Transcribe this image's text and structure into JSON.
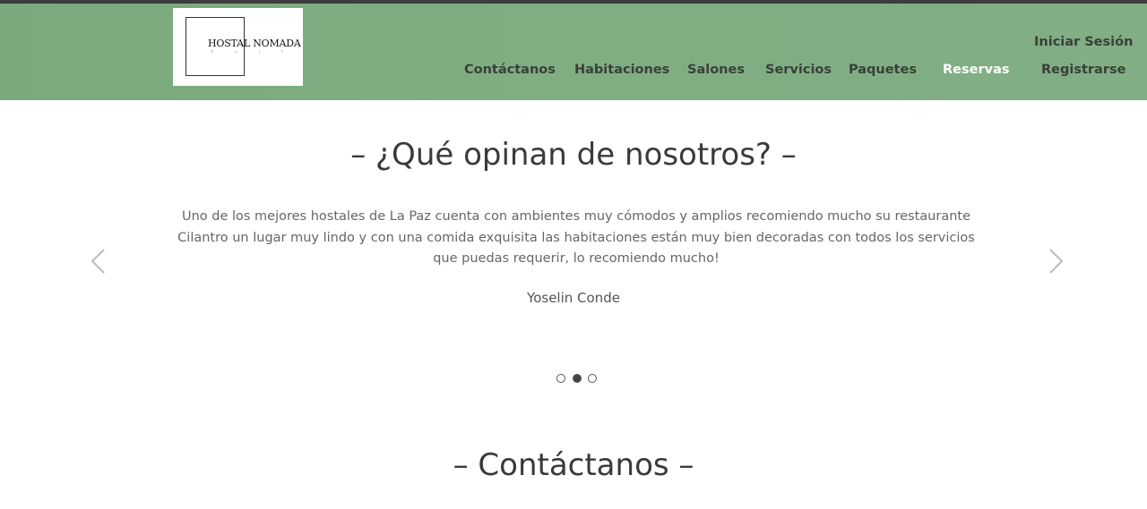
{
  "logo": {
    "title": "HOSTAL NOMADA",
    "subtitle": "S u i t e s"
  },
  "nav": {
    "login": "Iniciar Sesión",
    "items": [
      {
        "label": "Contáctanos"
      },
      {
        "label": "Habitaciones"
      },
      {
        "label": "Salones"
      },
      {
        "label": "Servicios"
      },
      {
        "label": "Paquetes"
      },
      {
        "label": "Reservas"
      },
      {
        "label": "Registrarse"
      }
    ],
    "active_item": "Reservas"
  },
  "testimonials": {
    "heading": "– ¿Qué opinan de nosotros? –",
    "text": "Uno de los mejores hostales de La Paz cuenta con ambientes muy cómodos y amplios recomiendo mucho su restaurante Cilantro un lugar muy lindo y con una comida exquisita las habitaciones están muy bien decoradas con todos los servicios que puedas requerir, lo recomiendo mucho!",
    "author": "Yoselin Conde",
    "prev_icon": "chevron-left-icon",
    "next_icon": "chevron-right-icon",
    "slide_count": 3,
    "active_slide": 2
  },
  "contact": {
    "heading": "– Contáctanos –"
  },
  "colors": {
    "header_green": "#80ae83",
    "top_strip": "#3d3d3d",
    "nav_text": "#3a3f3a",
    "nav_active": "#ffffff"
  }
}
